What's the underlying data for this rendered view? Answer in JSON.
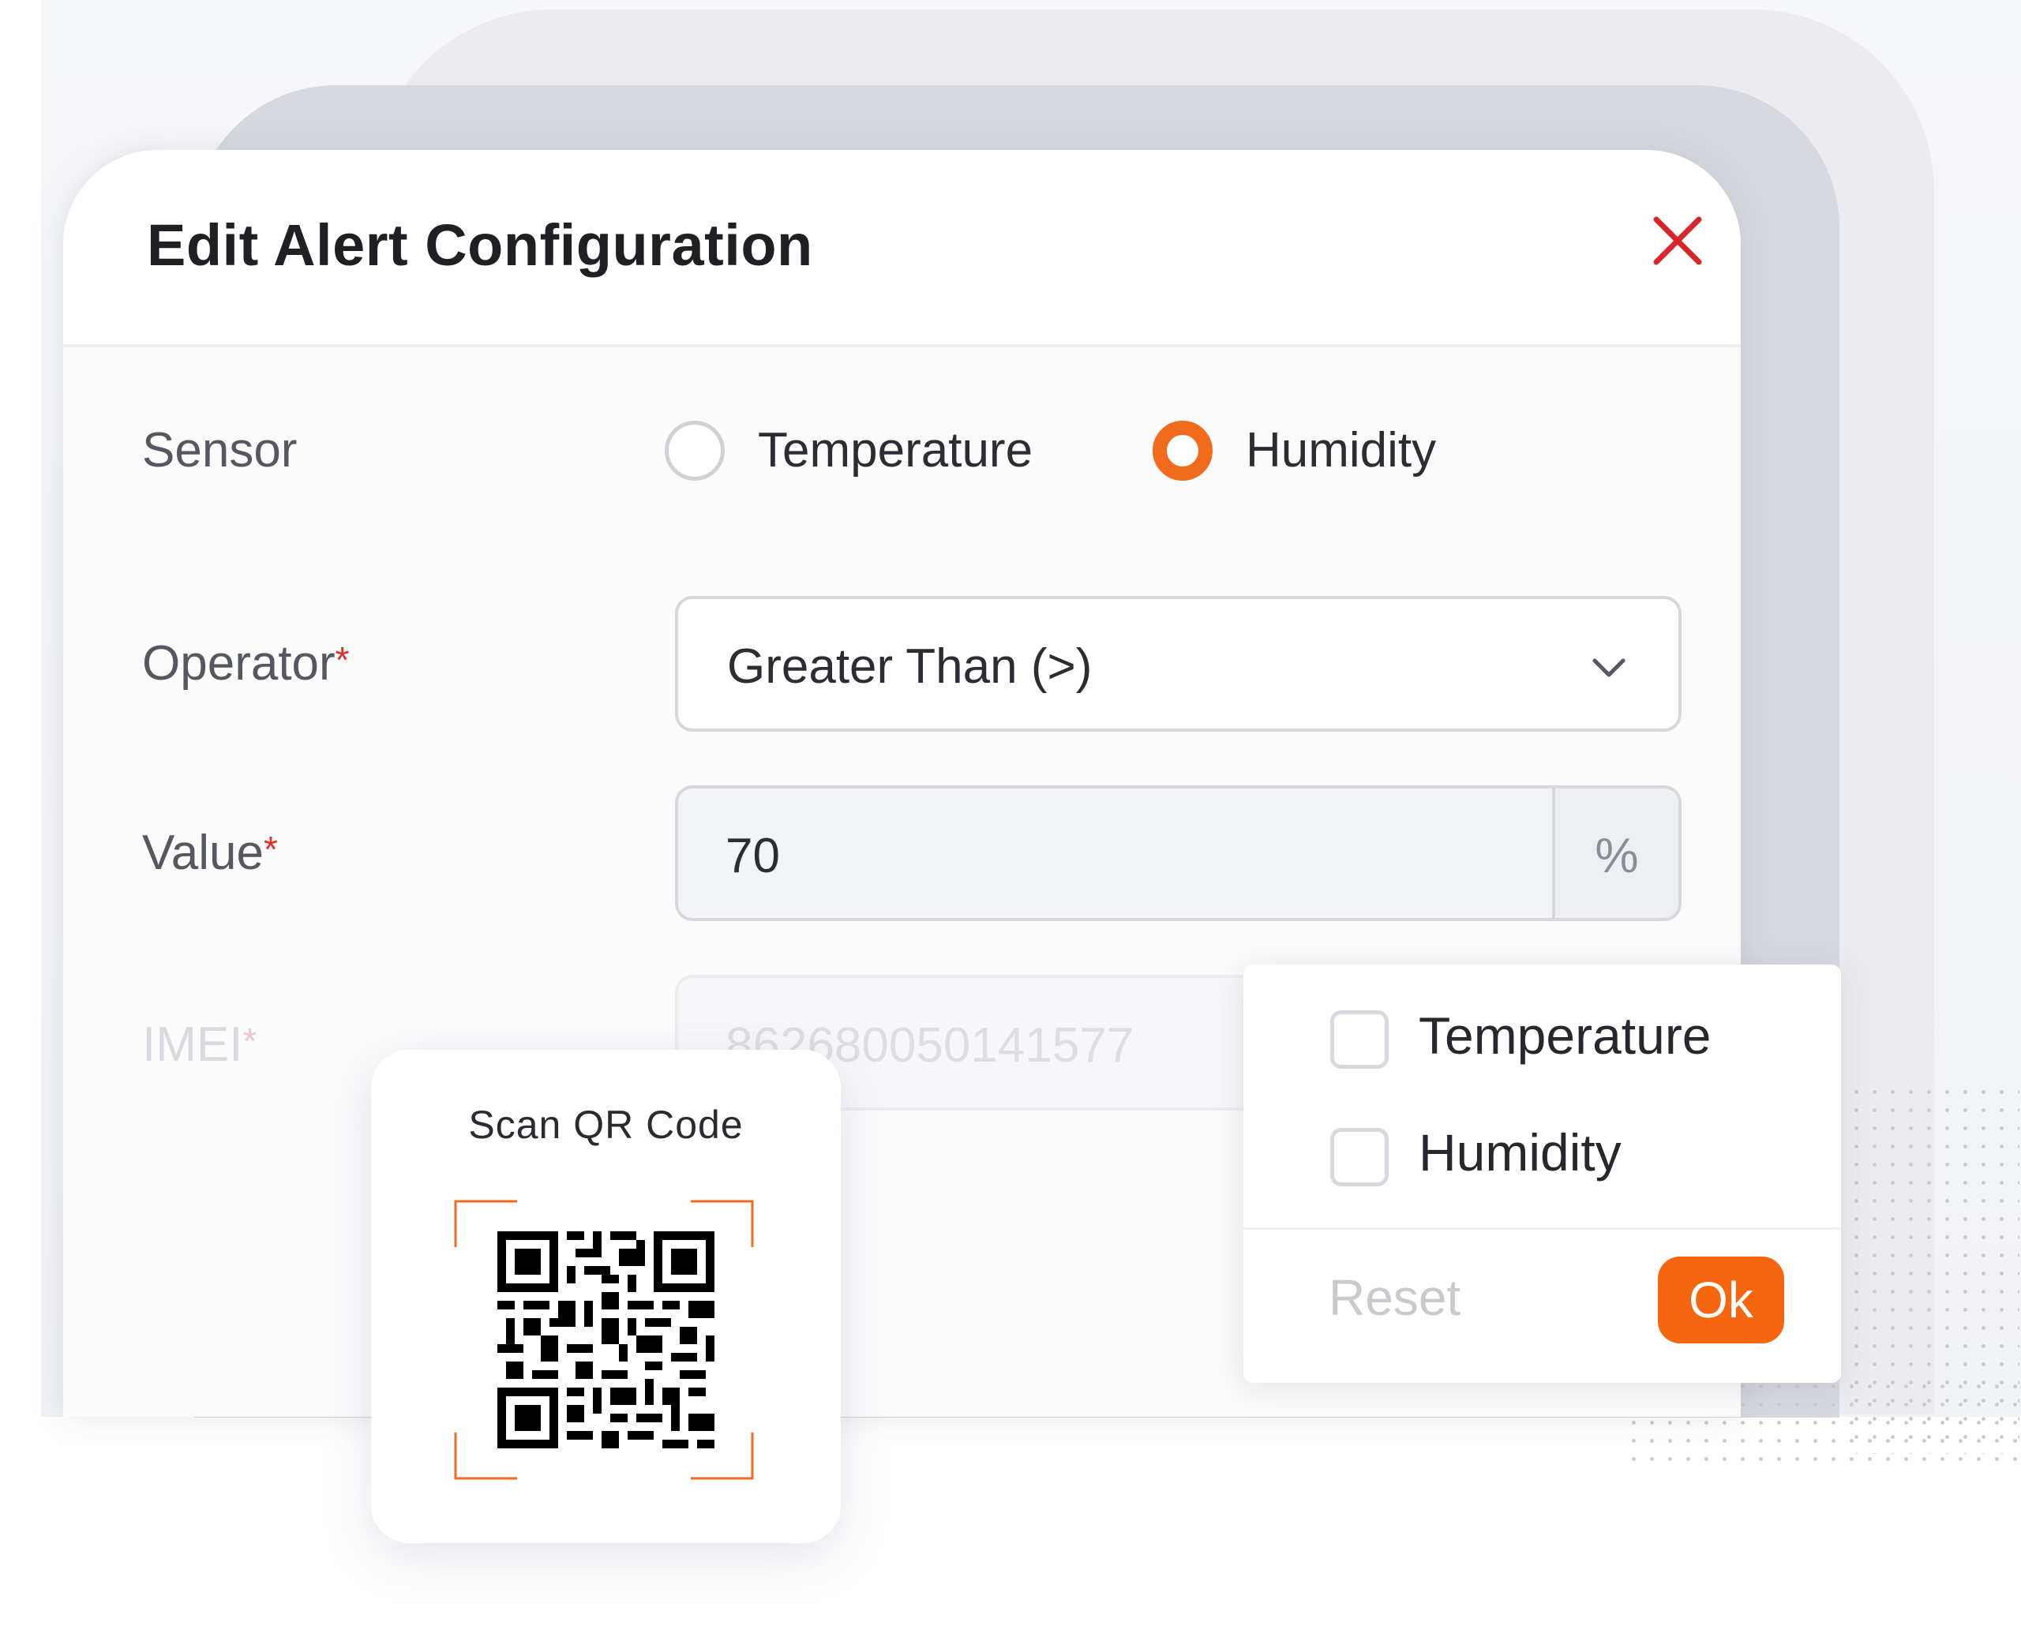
{
  "modal": {
    "title": "Edit Alert Configuration",
    "close_icon": "close-icon",
    "sensor": {
      "label": "Sensor",
      "options": [
        {
          "label": "Temperature",
          "selected": false
        },
        {
          "label": "Humidity",
          "selected": true
        }
      ]
    },
    "operator": {
      "label": "Operator",
      "required_mark": "*",
      "value": "Greater Than (>)",
      "icon": "chevron-down-icon"
    },
    "value_field": {
      "label": "Value",
      "required_mark": "*",
      "value": "70",
      "unit": "%"
    },
    "imei": {
      "label": "IMEI",
      "required_mark": "*",
      "value": "862680050141577"
    }
  },
  "qr_card": {
    "title": "Scan QR Code",
    "icon": "qr-code-icon"
  },
  "filter_popover": {
    "options": [
      {
        "label": "Temperature",
        "checked": false
      },
      {
        "label": "Humidity",
        "checked": false
      }
    ],
    "reset_label": "Reset",
    "ok_label": "Ok"
  },
  "colors": {
    "accent": "#f26a1b",
    "close": "#d9262b",
    "required": "#e0302a"
  }
}
